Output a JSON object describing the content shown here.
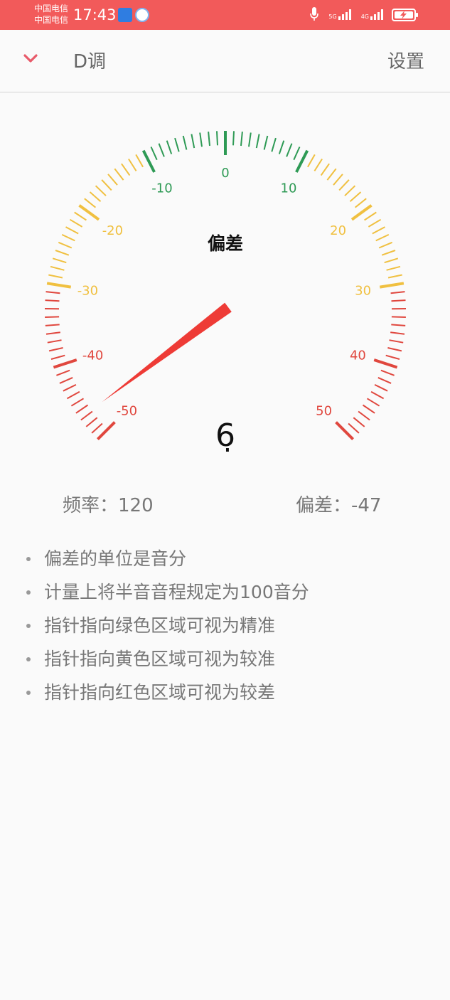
{
  "status_bar": {
    "carrier_1": "中国电信",
    "carrier_2": "中国电信",
    "time": "17:43",
    "network_1": "5G",
    "network_2": "4G",
    "background_color": "#f25a5a"
  },
  "header": {
    "key": "D调",
    "settings_label": "设置",
    "collapse_icon": "chevron-down-icon",
    "accent_color": "#e85a6a"
  },
  "gauge": {
    "title": "偏差",
    "range": [
      -50,
      50
    ],
    "tick_labels": [
      "-50",
      "-40",
      "-30",
      "-20",
      "-10",
      "0",
      "10",
      "20",
      "30",
      "40",
      "50"
    ],
    "deviation_cents": -47,
    "note_symbol": "6̣",
    "zones": [
      {
        "name": "green",
        "range": [
          -10,
          10
        ],
        "color": "#2e9a55"
      },
      {
        "name": "yellow",
        "range": [
          -30,
          30
        ],
        "color": "#f0c040"
      },
      {
        "name": "red",
        "range": [
          -50,
          50
        ],
        "color": "#e0473e"
      }
    ],
    "needle_color": "#ee3b36"
  },
  "readouts": {
    "frequency": "频率：120",
    "deviation": "偏差：-47"
  },
  "notes": [
    "偏差的单位是音分",
    "计量上将半音音程规定为100音分",
    "指针指向绿色区域可视为精准",
    "指针指向黄色区域可视为较准",
    "指针指向红色区域可视为较差"
  ]
}
